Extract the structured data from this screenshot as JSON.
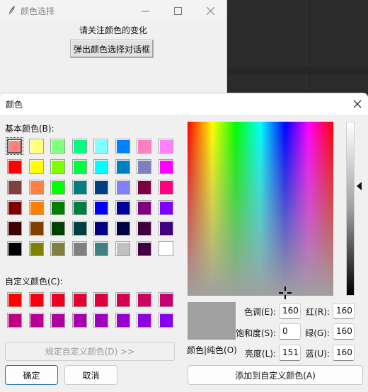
{
  "app": {
    "title": "颜色选择",
    "label": "请关注颜色的变化",
    "button_label": "弹出颜色选择对话框"
  },
  "dialog": {
    "title": "颜色",
    "basic_colors_label": "基本颜色(B):",
    "basic_colors": [
      "#ff8080",
      "#ffff80",
      "#80ff80",
      "#00ff80",
      "#80ffff",
      "#0080ff",
      "#ff80c0",
      "#ff80ff",
      "#ff0000",
      "#ffff00",
      "#80ff00",
      "#00ff40",
      "#00ffff",
      "#0080c0",
      "#8080c0",
      "#ff00ff",
      "#804040",
      "#ff8040",
      "#00ff00",
      "#008080",
      "#004080",
      "#8080ff",
      "#800040",
      "#ff0080",
      "#800000",
      "#ff8000",
      "#008000",
      "#008040",
      "#0000ff",
      "#0000a0",
      "#800080",
      "#8000ff",
      "#400000",
      "#804000",
      "#004000",
      "#004040",
      "#000080",
      "#000040",
      "#400040",
      "#400080",
      "#000000",
      "#808000",
      "#808040",
      "#808080",
      "#408080",
      "#c0c0c0",
      "#400040",
      "#ffffff"
    ],
    "custom_colors_label": "自定义颜色(C):",
    "custom_colors": [
      "#ff0000",
      "#f70010",
      "#ef0020",
      "#e70030",
      "#df0040",
      "#d70050",
      "#cf0060",
      "#c70070",
      "#bf0080",
      "#b70090",
      "#af00a0",
      "#a700b0",
      "#9f00c0",
      "#9700d0",
      "#8f00e0",
      "#8700f0"
    ],
    "define_custom_label": "规定自定义颜色(D) >>",
    "ok_label": "确定",
    "cancel_label": "取消",
    "preview_label": "颜色|纯色(O)",
    "fields": {
      "hue": {
        "label": "色调(E):",
        "value": "160"
      },
      "sat": {
        "label": "饱和度(S):",
        "value": "0"
      },
      "lum": {
        "label": "亮度(L):",
        "value": "151"
      },
      "red": {
        "label": "红(R):",
        "value": "160"
      },
      "green": {
        "label": "绿(G):",
        "value": "160"
      },
      "blue": {
        "label": "蓝(U):",
        "value": "160"
      }
    },
    "add_custom_label": "添加到自定义颜色(A)",
    "current_color": "#a0a0a0"
  }
}
